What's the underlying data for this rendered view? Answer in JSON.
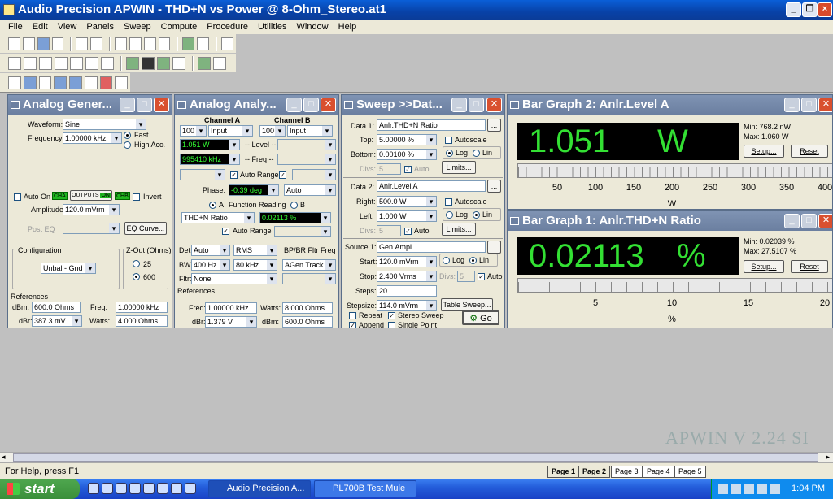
{
  "window": {
    "title": "Audio Precision APWIN - THD+N vs Power @ 8-Ohm_Stereo.at1",
    "controls": [
      "_",
      "❐",
      "×"
    ]
  },
  "menu": [
    "File",
    "Edit",
    "View",
    "Panels",
    "Sweep",
    "Compute",
    "Procedure",
    "Utilities",
    "Window",
    "Help"
  ],
  "gen": {
    "title": "Analog Gener...",
    "waveform_label": "Waveform:",
    "waveform": "Sine",
    "frequency_label": "Frequency:",
    "frequency": "1.00000 kHz",
    "fast": "Fast",
    "high_acc": "High Acc.",
    "auto_on": "Auto On",
    "chA": "CHA",
    "outputs": "OUTPUTS",
    "on": "ON",
    "chB": "CHB",
    "invert": "Invert",
    "amplitude_label": "Amplitude:",
    "amplitude": "120.0 mVrm",
    "post_eq": "Post EQ",
    "eq_curve": "EQ Curve...",
    "configuration": "Configuration",
    "config_value": "Unbal - Gnd",
    "zout": "Z-Out (Ohms)",
    "z25": "25",
    "z600": "600",
    "references": "References",
    "dbm_label": "dBm:",
    "dbm": "600.0  Ohms",
    "freq_label": "Freq:",
    "freq": "1.00000 kHz",
    "dbr_label": "dBr:",
    "dbr": "387.3  mV",
    "watts_label": "Watts:",
    "watts": "4.000  Ohms"
  },
  "ana": {
    "title": "Analog Analy...",
    "chA": "Channel A",
    "chB": "Channel B",
    "range_a": "100",
    "input_a": "Input",
    "range_b": "100",
    "input_b": "Input",
    "level_a": "1.051  W",
    "level_label": "-- Level --",
    "freq_a": "995410 kHz",
    "freq_label": "-- Freq --",
    "auto_range": "Auto Range",
    "phase_label": "Phase:",
    "phase": "-0.39  deg",
    "phase_auto": "Auto",
    "a": "A",
    "function_reading": "Function Reading",
    "b": "B",
    "function": "THD+N Ratio",
    "reading": "0.02113  %",
    "auto_range2": "Auto Range",
    "det_label": "Det:",
    "det": "Auto",
    "rms": "RMS",
    "bp_br": "BP/BR Fltr Freq",
    "bw_label": "BW:",
    "bw_lo": "400 Hz",
    "bw_hi": "80 kHz",
    "agen": "AGen Track",
    "fltr_label": "Fltr:",
    "fltr": "None",
    "references": "References",
    "freq_label2": "Freq:",
    "freq": "1.00000 kHz",
    "watts_label": "Watts:",
    "watts": "8.000  Ohms",
    "dbr_label": "dBr:",
    "dbr": "1.379  V",
    "dbm_label": "dBm:",
    "dbm": "600.0  Ohms"
  },
  "sweep": {
    "title": "Sweep >>Dat...",
    "data1_label": "Data 1:",
    "data1": "Anlr.THD+N Ratio",
    "top_label": "Top:",
    "top": "5.00000  %",
    "autoscale": "Autoscale",
    "bottom_label": "Bottom:",
    "bottom": "0.00100  %",
    "log": "Log",
    "lin": "Lin",
    "divs_label": "Divs:",
    "divs": "5",
    "auto": "Auto",
    "limits": "Limits...",
    "data2_label": "Data 2:",
    "data2": "Anlr.Level A",
    "right_label": "Right:",
    "right": "500.0  W",
    "left_label": "Left:",
    "left": "1.000  W",
    "source1_label": "Source 1:",
    "source1": "Gen.Ampl",
    "start_label": "Start:",
    "start": "120.0  mVrm",
    "stop_label": "Stop:",
    "stop": "2.400  Vrms",
    "steps_label": "Steps:",
    "steps": "20",
    "stepsize_label": "Stepsize:",
    "stepsize": "114.0  mVrm",
    "table_sweep": "Table Sweep...",
    "repeat": "Repeat",
    "stereo_sweep": "Stereo Sweep",
    "append": "Append",
    "single_point": "Single Point",
    "go": "Go"
  },
  "bar2": {
    "title": "Bar Graph 2: Anlr.Level A",
    "value": "1.051",
    "unit": "W",
    "min": "Min: 768.2  nW",
    "max": "Max: 1.060  W",
    "setup": "Setup...",
    "reset": "Reset",
    "ticks": [
      "50",
      "100",
      "150",
      "200",
      "250",
      "300",
      "350",
      "400"
    ],
    "axis_unit": "W"
  },
  "bar1": {
    "title": "Bar Graph 1: Anlr.THD+N Ratio",
    "value": "0.02113",
    "unit": "%",
    "min": "Min: 0.02039  %",
    "max": "Max: 27.5107  %",
    "setup": "Setup...",
    "reset": "Reset",
    "ticks": [
      "5",
      "10",
      "15",
      "20"
    ],
    "axis_unit": "%"
  },
  "watermark": "APWIN V 2.24  SI",
  "status": {
    "help": "For Help, press F1",
    "pages": [
      "Page 1",
      "Page 2",
      "Page 3",
      "Page 4",
      "Page 5"
    ]
  },
  "taskbar": {
    "start": "start",
    "tasks": [
      "Audio Precision A...",
      "PL700B Test Mule"
    ],
    "clock": "1:04 PM"
  }
}
